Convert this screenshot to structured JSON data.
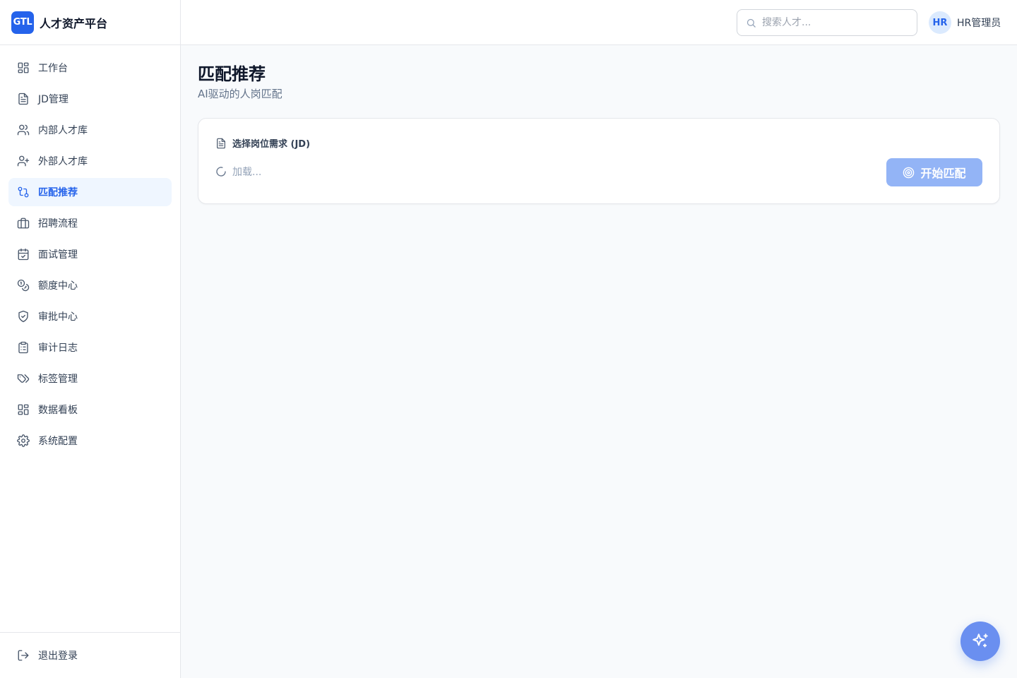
{
  "brand": {
    "logo": "GTL",
    "name": "人才资产平台"
  },
  "sidebar": {
    "items": [
      {
        "label": "工作台",
        "icon": "grid-icon"
      },
      {
        "label": "JD管理",
        "icon": "document-icon"
      },
      {
        "label": "内部人才库",
        "icon": "users-icon"
      },
      {
        "label": "外部人才库",
        "icon": "user-plus-icon"
      },
      {
        "label": "匹配推荐",
        "icon": "git-compare-icon",
        "active": true
      },
      {
        "label": "招聘流程",
        "icon": "briefcase-icon"
      },
      {
        "label": "面试管理",
        "icon": "calendar-check-icon"
      },
      {
        "label": "额度中心",
        "icon": "coins-icon"
      },
      {
        "label": "审批中心",
        "icon": "shield-check-icon"
      },
      {
        "label": "审计日志",
        "icon": "clipboard-list-icon"
      },
      {
        "label": "标签管理",
        "icon": "tags-icon"
      },
      {
        "label": "数据看板",
        "icon": "dashboard-icon"
      },
      {
        "label": "系统配置",
        "icon": "gear-icon"
      }
    ],
    "logout_label": "退出登录"
  },
  "topbar": {
    "search_placeholder": "搜索人才...",
    "avatar_text": "HR",
    "user_name": "HR管理员"
  },
  "page": {
    "title": "匹配推荐",
    "subtitle": "AI驱动的人岗匹配"
  },
  "card": {
    "heading": "选择岗位需求 (JD)",
    "loading_text": "加载...",
    "match_button": "开始匹配"
  },
  "colors": {
    "accent": "#2563eb",
    "active_bg": "#eff6ff",
    "button_disabled": "#93b4f6",
    "fab": "#6a8ff0"
  }
}
